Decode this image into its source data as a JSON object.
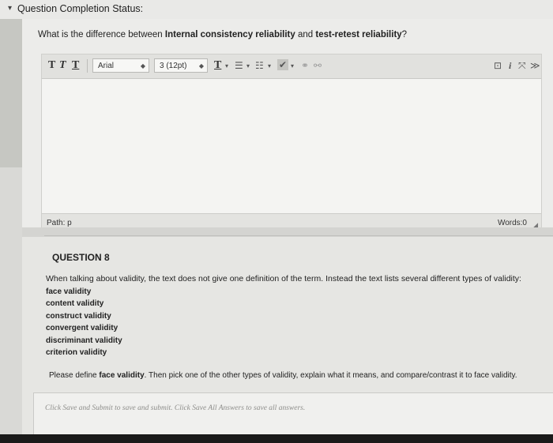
{
  "status": {
    "chevron": "▾",
    "title": "Question Completion Status:"
  },
  "question7": {
    "text_before": "What is the difference between ",
    "bold1": "Internal consistency reliability",
    "text_mid": " and ",
    "bold2": "test-retest reliability",
    "text_after": "?"
  },
  "toolbar": {
    "btn1": "T",
    "btn2": "T",
    "btn3": "T",
    "font_family": "Arial",
    "font_size": "3 (12pt)",
    "text_color_btn": "T"
  },
  "editor": {
    "path_label": "Path: p",
    "words_label": "Words:0"
  },
  "question8": {
    "title": "QUESTION 8",
    "intro": "When talking about validity, the text does not give one definition of the term. Instead the text lists several different types of validity:",
    "validity_types": [
      "face validity",
      "content validity",
      "construct validity",
      "convergent validity",
      "discriminant validity",
      "criterion validity"
    ],
    "prompt_before": "Please define ",
    "prompt_bold": "face validity",
    "prompt_after": ". Then pick one of the other types of validity, explain what it means, and compare/contrast it to face validity."
  },
  "answer_hint": "Click Save and Submit to save and submit. Click Save All Answers to save all answers."
}
